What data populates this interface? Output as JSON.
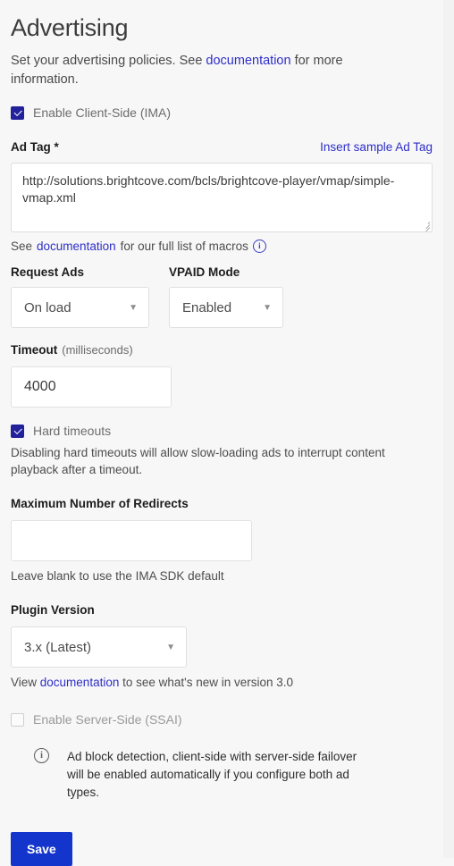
{
  "page": {
    "title": "Advertising",
    "intro_before": "Set your advertising policies. See ",
    "intro_link": "documentation",
    "intro_after": " for more information."
  },
  "client_side": {
    "enable_label": "Enable Client-Side (IMA)",
    "enable_checked": true
  },
  "ad_tag": {
    "label": "Ad Tag *",
    "insert_sample_link": "Insert sample Ad Tag",
    "value": "http://solutions.brightcove.com/bcls/brightcove-player/vmap/simple-vmap.xml",
    "placeholder": "",
    "helper_before": "See ",
    "helper_link": "documentation",
    "helper_after": " for our full list of macros ",
    "helper_info_icon": "info-icon",
    "resize_handle": "resize-grip-icon"
  },
  "request_ads": {
    "label": "Request Ads",
    "value": "On load",
    "caret_icon": "chevron-down-icon"
  },
  "vpaid_mode": {
    "label": "VPAID Mode",
    "value": "Enabled",
    "caret_icon": "chevron-down-icon"
  },
  "timeout": {
    "label": "Timeout",
    "unit": "(milliseconds)",
    "value": "4000",
    "placeholder": ""
  },
  "hard_timeouts": {
    "label": "Hard timeouts",
    "checked": true,
    "description": "Disabling hard timeouts will allow slow-loading ads to interrupt content playback after a timeout."
  },
  "max_redirects": {
    "label": "Maximum Number of Redirects",
    "value": "",
    "placeholder": "",
    "helper": "Leave blank to use the IMA SDK default"
  },
  "plugin_version": {
    "label": "Plugin Version",
    "value": "3.x (Latest)",
    "caret_icon": "chevron-down-icon",
    "helper_before": "View ",
    "helper_link": "documentation",
    "helper_after": " to see what's new in version 3.0"
  },
  "server_side": {
    "enable_label": "Enable Server-Side (SSAI)",
    "enable_checked": false
  },
  "note": {
    "icon": "info-icon",
    "text": "Ad block detection, client-side with server-side failover will be enabled automatically if you configure both ad types."
  },
  "footer": {
    "save_label": "Save"
  },
  "colors": {
    "accent_link": "#2e2ec9",
    "checkbox_checked": "#22219b",
    "save_button": "#1435cc",
    "page_background": "#f7f7f7",
    "input_background": "#ffffff"
  }
}
